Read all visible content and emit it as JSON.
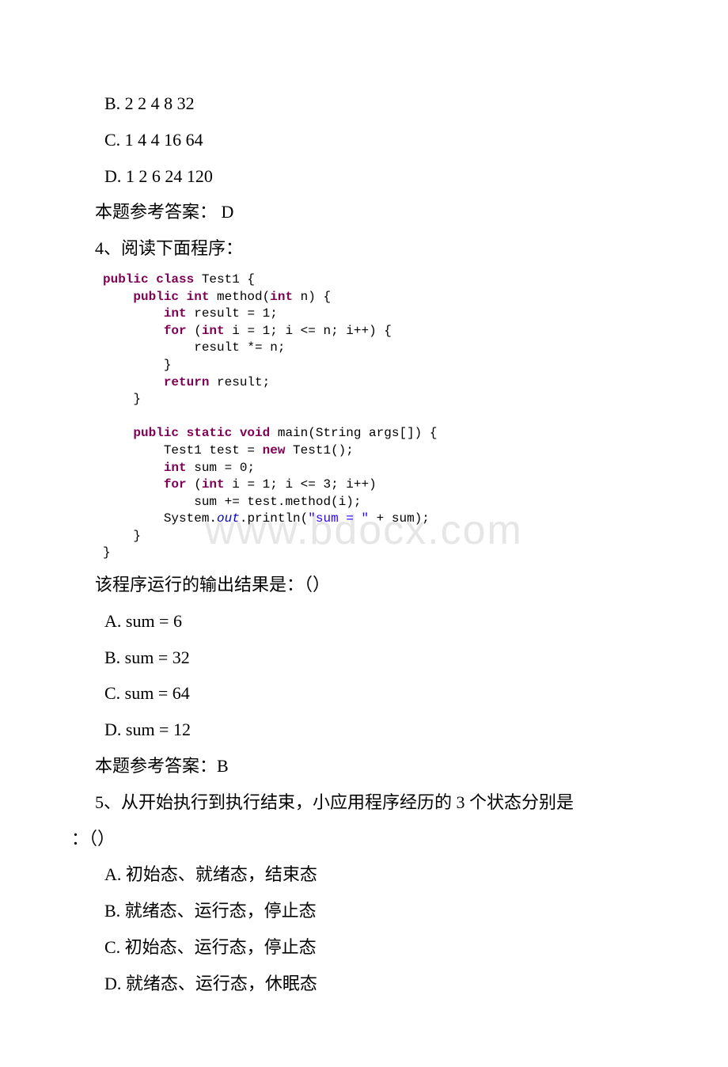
{
  "watermark": "www.bdocx.com",
  "q3_options": {
    "b": " B. 2 2 4 8 32",
    "c": " C. 1 4 4 16 64",
    "d": " D. 1 2 6 24 120"
  },
  "q3_answer": "本题参考答案： D",
  "q4": {
    "prompt": "4、阅读下面程序：",
    "result_prompt": "该程序运行的输出结果是：（）",
    "options": {
      "a": " A. sum = 6",
      "b": " B. sum = 32",
      "c": " C. sum = 64",
      "d": " D. sum = 12"
    },
    "answer": "本题参考答案：B"
  },
  "q5": {
    "prompt_line1": "5、从开始执行到执行结束，小应用程序经历的 3 个状态分别是",
    "prompt_line2": "：（）",
    "options": {
      "a": " A. 初始态、就绪态，结束态",
      "b": " B. 就绪态、运行态，停止态",
      "c": " C. 初始态、运行态，停止态",
      "d": " D. 就绪态、运行态，休眠态"
    }
  },
  "code": {
    "class_decl_pre": "public class",
    "class_name": " Test1 {",
    "method_sig_pre": "    public int",
    "method_sig_post": " method(",
    "method_param_type": "int",
    "method_param_rest": " n) {",
    "int_kw": "int",
    "result_decl": " result = 1;",
    "for_kw": "for",
    "for_open": " (",
    "for_init": " i = 1; i <= n; i++) {",
    "result_mul": "            result *= n;",
    "close_brace_8": "        }",
    "return_kw": "return",
    "return_stmt": " result;",
    "close_brace_4": "    }",
    "main_sig_pre": "    public static void",
    "main_sig_post": " main(String args[]) {",
    "test_new_pre": "        Test1 test = ",
    "new_kw": "new",
    "test_new_post": " Test1();",
    "sum_decl": " sum = 0;",
    "for_main_init": " i = 1; i <= 3; i++)",
    "sum_add": "            sum += test.method(i);",
    "sysout_pre": "        System.",
    "out": "out",
    "println_open": ".println(",
    "sum_str": "\"sum = \"",
    "println_close": " + sum);",
    "close_brace_0": "}"
  }
}
